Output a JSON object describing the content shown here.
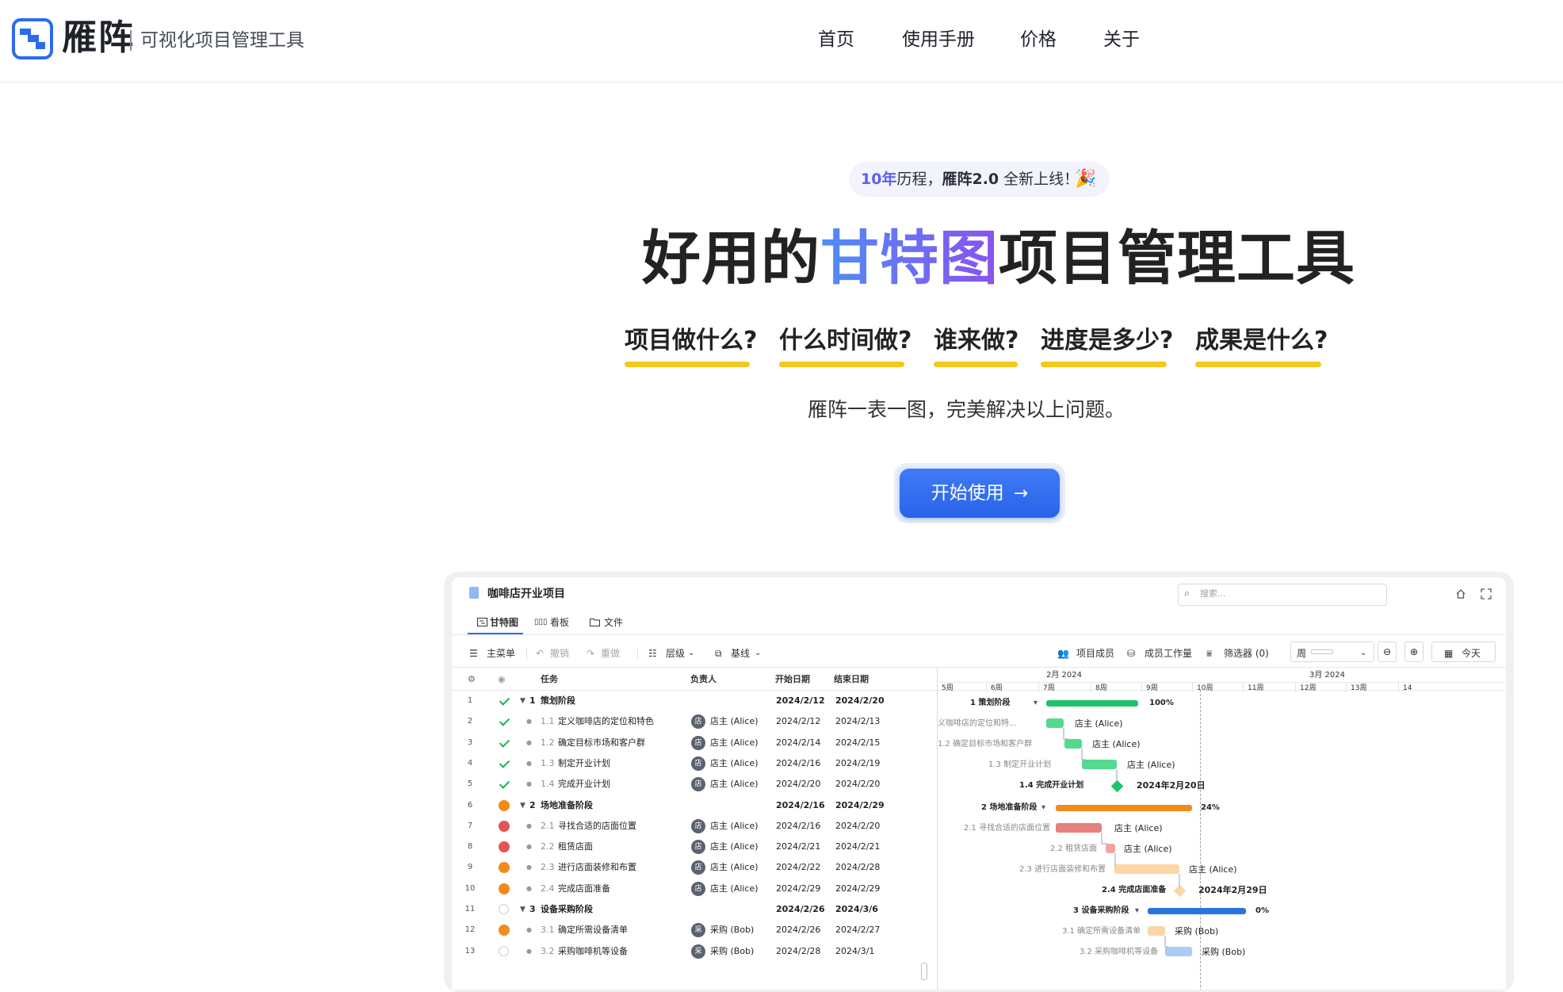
{
  "brand": {
    "name": "雁阵",
    "tagline": "可视化项目管理工具",
    "accent": "#2b6bf0"
  },
  "nav": [
    {
      "label": "首页"
    },
    {
      "label": "使用手册"
    },
    {
      "label": "价格"
    },
    {
      "label": "关于"
    }
  ],
  "hero": {
    "pill": {
      "years": "10年",
      "text_mid": "历程，",
      "version": "雁阵2.0",
      "text_end": " 全新上线！",
      "icon": "party-popper-icon"
    },
    "title_pre": "好用的",
    "title_highlight": "甘特图",
    "title_post": "项目管理工具",
    "questions": [
      "项目做什么?",
      "什么时间做?",
      "谁来做?",
      "进度是多少?",
      "成果是什么?"
    ],
    "description": "雁阵一表一图，完美解决以上问题。",
    "cta": "开始使用"
  },
  "app": {
    "project_title": "咖啡店开业项目",
    "search_placeholder": "搜索...",
    "tabs": [
      {
        "label": "甘特图",
        "active": true
      },
      {
        "label": "看板"
      },
      {
        "label": "文件"
      }
    ],
    "toolbar": {
      "menu": "主菜单",
      "undo": "撤销",
      "redo": "重做",
      "level": "层级",
      "baseline": "基线",
      "members": "项目成员",
      "workload": "成员工作量",
      "filter": "筛选器 (0)",
      "scale": "周",
      "today": "今天"
    },
    "columns": {
      "task": "任务",
      "owner": "负责人",
      "start": "开始日期",
      "end": "结束日期"
    },
    "rows": [
      {
        "n": "1",
        "status": "done",
        "idx": "1",
        "name": "策划阶段",
        "group": true,
        "owner": "",
        "start": "2024/2/12",
        "end": "2024/2/20"
      },
      {
        "n": "2",
        "status": "done",
        "idx": "1.1",
        "name": "定义咖啡店的定位和特色",
        "owner": "店主 (Alice)",
        "start": "2024/2/12",
        "end": "2024/2/13"
      },
      {
        "n": "3",
        "status": "done",
        "idx": "1.2",
        "name": "确定目标市场和客户群",
        "owner": "店主 (Alice)",
        "start": "2024/2/14",
        "end": "2024/2/15"
      },
      {
        "n": "4",
        "status": "done",
        "idx": "1.3",
        "name": "制定开业计划",
        "owner": "店主 (Alice)",
        "start": "2024/2/16",
        "end": "2024/2/19"
      },
      {
        "n": "5",
        "status": "done",
        "idx": "1.4",
        "name": "完成开业计划",
        "owner": "店主 (Alice)",
        "start": "2024/2/20",
        "end": "2024/2/20"
      },
      {
        "n": "6",
        "status": "prog",
        "idx": "2",
        "name": "场地准备阶段",
        "group": true,
        "owner": "",
        "start": "2024/2/16",
        "end": "2024/2/29"
      },
      {
        "n": "7",
        "status": "red",
        "idx": "2.1",
        "name": "寻找合适的店面位置",
        "owner": "店主 (Alice)",
        "start": "2024/2/16",
        "end": "2024/2/20"
      },
      {
        "n": "8",
        "status": "red",
        "idx": "2.2",
        "name": "租赁店面",
        "owner": "店主 (Alice)",
        "start": "2024/2/21",
        "end": "2024/2/21"
      },
      {
        "n": "9",
        "status": "prog",
        "idx": "2.3",
        "name": "进行店面装修和布置",
        "owner": "店主 (Alice)",
        "start": "2024/2/22",
        "end": "2024/2/28"
      },
      {
        "n": "10",
        "status": "prog",
        "idx": "2.4",
        "name": "完成店面准备",
        "owner": "店主 (Alice)",
        "start": "2024/2/29",
        "end": "2024/2/29"
      },
      {
        "n": "11",
        "status": "todo",
        "idx": "3",
        "name": "设备采购阶段",
        "group": true,
        "owner": "",
        "start": "2024/2/26",
        "end": "2024/3/6"
      },
      {
        "n": "12",
        "status": "prog",
        "idx": "3.1",
        "name": "确定所需设备清单",
        "owner": "采购 (Bob)",
        "start": "2024/2/26",
        "end": "2024/2/27"
      },
      {
        "n": "13",
        "status": "todo",
        "idx": "3.2",
        "name": "采购咖啡机等设备",
        "owner": "采购 (Bob)",
        "start": "2024/2/28",
        "end": "2024/3/1"
      }
    ],
    "timeline": {
      "months": [
        "2月 2024",
        "3月 2024"
      ],
      "weeks": [
        "5周",
        "6周",
        "7周",
        "8周",
        "9周",
        "10周",
        "11周",
        "12周",
        "13周",
        "14"
      ]
    },
    "gantt": {
      "p1_label": "1 策划阶段",
      "p1_pct": "100%",
      "t11_label": "义咖啡店的定位和特...",
      "t12_label": "1.2 确定目标市场和客户群",
      "t13_label": "1.3 制定开业计划",
      "m14_label": "1.4 完成开业计划",
      "m14_date": "2024年2月20日",
      "p2_label": "2 场地准备阶段",
      "p2_pct": "24%",
      "t21_label": "2.1 寻找合适的店面位置",
      "t22_label": "2.2 租赁店面",
      "t23_label": "2.3 进行店面装修和布置",
      "m24_label": "2.4 完成店面准备",
      "m24_date": "2024年2月29日",
      "p3_label": "3 设备采购阶段",
      "p3_pct": "0%",
      "t31_label": "3.1 确定所需设备清单",
      "t32_label": "3.2 采购咖啡机等设备",
      "alice": "店主 (Alice)",
      "bob": "采购 (Bob)"
    },
    "avatars": {
      "alice": "店",
      "bob": "采"
    }
  }
}
